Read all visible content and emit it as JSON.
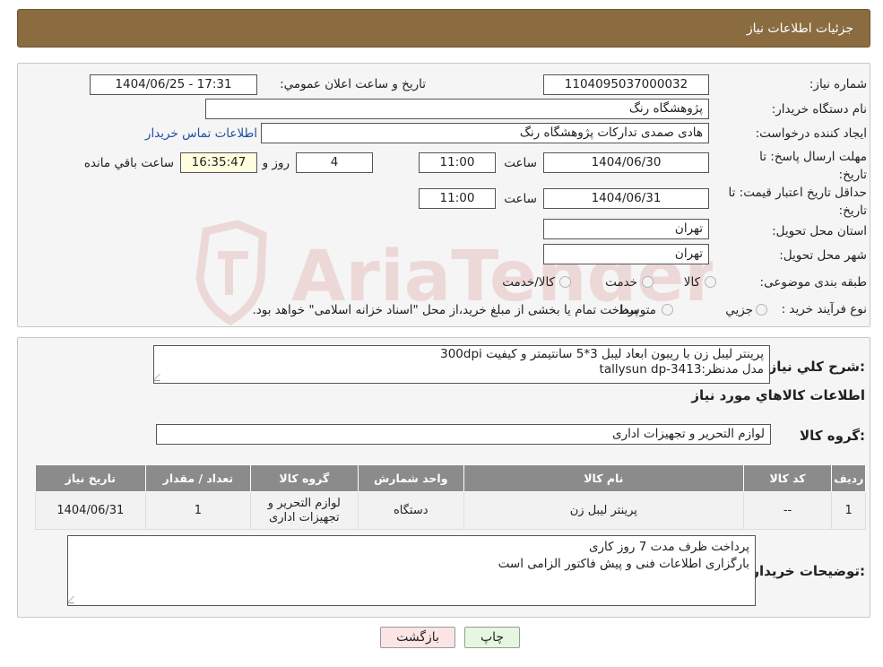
{
  "header": {
    "title": "جزئیات اطلاعات نیاز"
  },
  "form": {
    "need_number_label": "شماره نیاز:",
    "need_number": "1104095037000032",
    "announce_label": "تاریخ و ساعت اعلان عمومي:",
    "announce_value": "1404/06/25 - 17:31",
    "buyer_org_label": "نام دستگاه خريدار:",
    "buyer_org": "پژوهشگاه رنگ",
    "creator_label": "ايجاد کننده درخواست:",
    "creator": "هادی صمدی تدارکات پژوهشگاه رنگ",
    "contact_link": "اطلاعات تماس خريدار",
    "deadline_label_1": "مهلت ارسال پاسخ: تا",
    "deadline_label_2": "تاريخ:",
    "deadline_date": "1404/06/30",
    "time_label": "ساعت",
    "deadline_time": "11:00",
    "days": "4",
    "days_label": "روز و",
    "remaining_time": "16:35:47",
    "remaining_label": "ساعت باقي مانده",
    "validity_label_1": "حداقل تاريخ اعتبار قيمت: تا",
    "validity_label_2": "تاريخ:",
    "validity_date": "1404/06/31",
    "validity_time": "11:00",
    "province_label": "استان محل تحويل:",
    "province": "تهران",
    "city_label": "شهر محل تحويل:",
    "city": "تهران",
    "category_label": "طبقه بندی موضوعی:",
    "category_options": [
      "کالا",
      "خدمت",
      "کالا/خدمت"
    ],
    "process_label": "نوع فرآيند خريد :",
    "process_options": [
      "جزيي",
      "متوسط"
    ],
    "process_note": "پرداخت تمام يا بخشی از مبلغ خريد،از محل \"اسناد خزانه اسلامی\" خواهد بود."
  },
  "details": {
    "description_label": "شرح کلي نياز:",
    "description_lines": [
      "پرینتر لیبل زن با ریبون ابعاد لیبل 3*5 سانتیمتر و کیفیت 300dpi",
      "مدل مدنظر:tallysun dp-3413"
    ],
    "goods_info_title": "اطلاعات کالاهاي مورد نياز",
    "goods_group_label": "گروه کالا:",
    "goods_group": "لوازم التحرير و تجهيزات اداری"
  },
  "table": {
    "headers": [
      "رديف",
      "کد کالا",
      "نام کالا",
      "واحد شمارش",
      "گروه کالا",
      "تعداد / مقدار",
      "تاريخ نياز"
    ],
    "rows": [
      {
        "row": "1",
        "code": "--",
        "name": "پرينتر ليبل زن",
        "unit": "دستگاه",
        "group": "لوازم التحرير و تجهيزات اداری",
        "qty": "1",
        "date": "1404/06/31"
      }
    ]
  },
  "buyer_notes": {
    "label": "توضيحات خريدار:",
    "lines": [
      "پرداخت ظرف مدت 7 روز کاری",
      "بارگزاری اطلاعات فنی و پیش فاکتور الزامی است"
    ]
  },
  "buttons": {
    "print": "چاپ",
    "back": "بازگشت"
  },
  "watermark": {
    "text": "AriaTender.neT"
  },
  "colors": {
    "header_bg": "#8b6c40",
    "table_header_bg": "#8b8b8b",
    "back_button_bg": "#fde4e4",
    "print_button_bg": "#e6f7df"
  }
}
